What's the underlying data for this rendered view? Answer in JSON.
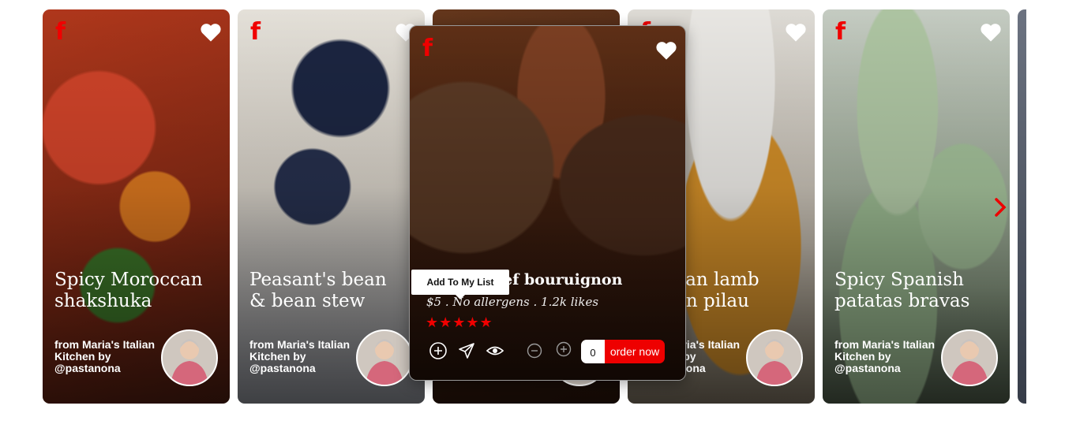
{
  "brand": {
    "logo_text": "f"
  },
  "colors": {
    "accent": "#ee0000",
    "text": "#ffffff"
  },
  "cards": [
    {
      "title": "Spicy Moroccan shakshuka",
      "from": "from Maria's Italian Kitchen by @pastanona"
    },
    {
      "title": "Peasant's bean & bean stew",
      "from": "from Maria's Italian Kitchen by @pastanona"
    },
    {
      "title": "",
      "from": ""
    },
    {
      "title": "Persian lamb safron pilau",
      "from": "from Maria's Italian Kitchen by @pastanona"
    },
    {
      "title": "Spicy Spanish patatas bravas",
      "from": "from Maria's Italian Kitchen by @pastanona"
    }
  ],
  "focused_card": {
    "title": "Beef bouruignon",
    "meta": "$5 . No allergens . 1.2k likes",
    "rating": 5,
    "stars": "★★★★★",
    "tooltip": "Add To My List",
    "quantity": "0",
    "order_label": "order now",
    "icons": [
      "plus-circle-icon",
      "send-icon",
      "eye-icon",
      "minus-circle-icon",
      "plus-circle-icon"
    ]
  },
  "nav": {
    "next_icon": "chevron-right-icon"
  }
}
